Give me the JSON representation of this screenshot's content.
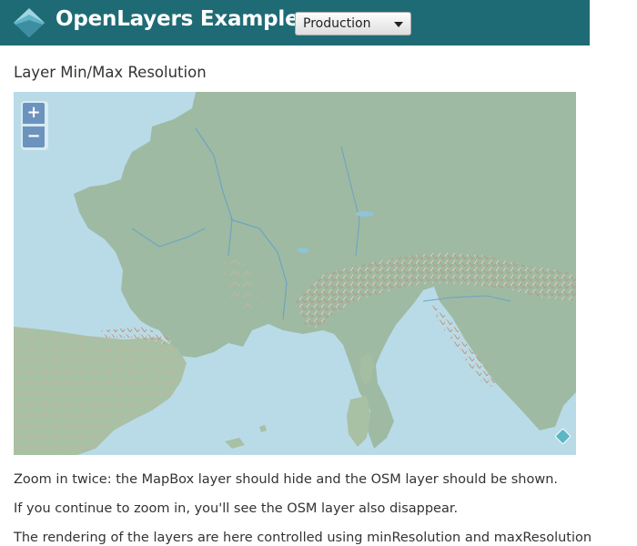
{
  "header": {
    "brand": "OpenLayers Examples",
    "logo_icon": "openlayers-logo-icon",
    "background": "#1f6b75",
    "select": {
      "value": "Production"
    }
  },
  "page": {
    "title": "Layer Min/Max Resolution"
  },
  "map": {
    "zoom_in_label": "+",
    "zoom_out_label": "−",
    "attribution_icon": "info-diamond-icon",
    "land_color": "#9fbaa3",
    "sea_color": "#b9dbe8"
  },
  "description": {
    "line1": "Zoom in twice: the MapBox layer should hide and the OSM layer should be shown.",
    "line2": "If you continue to zoom in, you'll see the OSM layer also disappear.",
    "line3": "The rendering of the layers are here controlled using minResolution and maxResolution"
  }
}
